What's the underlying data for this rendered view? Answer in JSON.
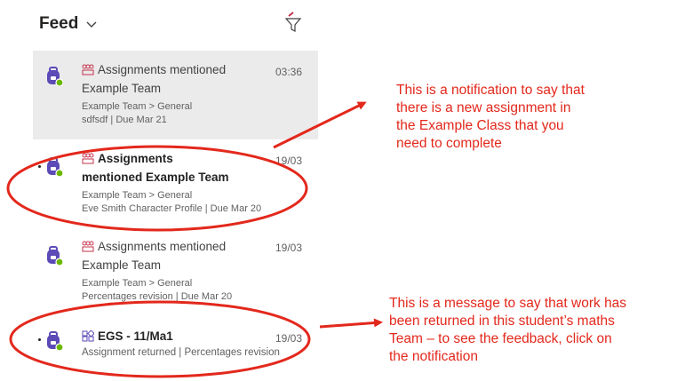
{
  "header": {
    "title": "Feed"
  },
  "items": [
    {
      "title": "Assignments mentioned",
      "team": "Example Team",
      "path": "Example Team > General",
      "detail": "sdfsdf | Due Mar 21",
      "time": "03:36"
    },
    {
      "title": "Assignments",
      "title2": "mentioned Example Team",
      "path": "Example Team > General",
      "detail": "Eve Smith Character Profile | Due Mar 20",
      "time": "19/03"
    },
    {
      "title": "Assignments mentioned",
      "team": "Example Team",
      "path": "Example Team > General",
      "detail": "Percentages revision | Due Mar 20",
      "time": "19/03"
    },
    {
      "title": "EGS - 11/Ma1",
      "detail": "Assignment returned | Percentages revision",
      "time": "19/03"
    }
  ],
  "annotations": {
    "note1": [
      "This is a notification to say that",
      "there is a new assignment in",
      "the Example Class that you",
      "need to complete"
    ],
    "note2": [
      "This is a message to say that work has",
      "been returned in this student’s maths",
      "Team – to see the feedback, click on",
      "the notification"
    ]
  },
  "colors": {
    "annotation": "#e3281c",
    "avatar": "#5c4ab7",
    "presence": "#6bb700",
    "selected": "#ebebeb"
  }
}
